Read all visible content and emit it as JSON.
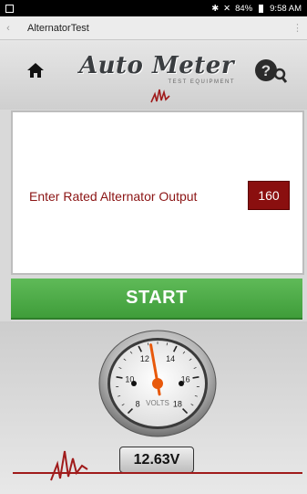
{
  "status_bar": {
    "battery": "84%",
    "time": "9:58 AM"
  },
  "action_bar": {
    "title": "AlternatorTest"
  },
  "header": {
    "brand_name": "Auto Meter",
    "brand_sub": "TEST EQUIPMENT",
    "home_icon": "home-icon",
    "help_icon": "help-search-icon"
  },
  "form": {
    "rated_label": "Enter Rated Alternator Output",
    "rated_value": "160"
  },
  "start_button": {
    "label": "START"
  },
  "gauge": {
    "ticks": [
      "8",
      "10",
      "12",
      "14",
      "16",
      "18"
    ],
    "unit_label": "VOLTS",
    "value": 12.63,
    "min": 8,
    "max": 18
  },
  "readout": {
    "voltage": "12.63V"
  },
  "colors": {
    "accent_red": "#8a0f0f",
    "start_green": "#4caf50",
    "brand_gray": "#3a3d40"
  }
}
